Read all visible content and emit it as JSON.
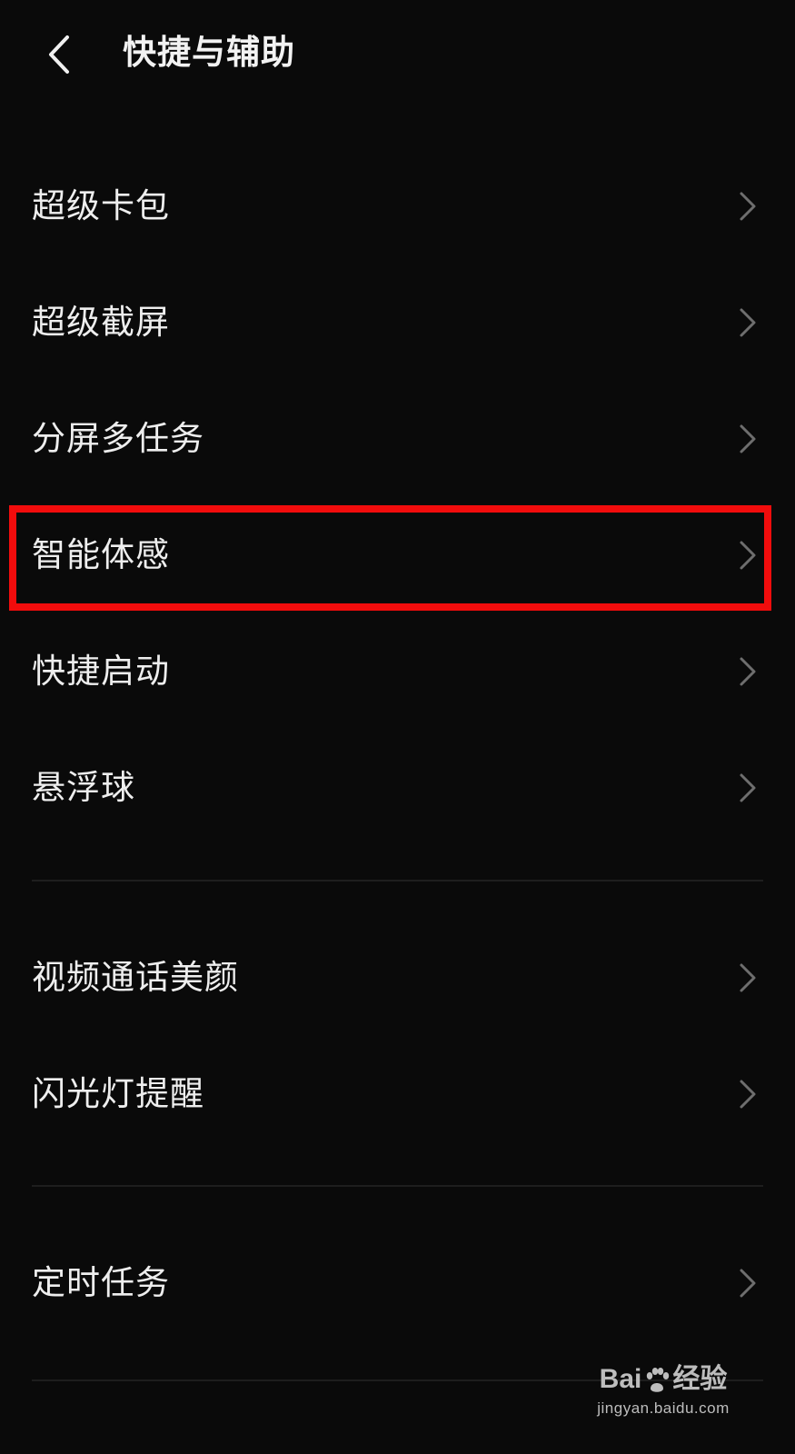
{
  "header": {
    "title": "快捷与辅助",
    "back_icon": "chevron-left-icon"
  },
  "items": [
    {
      "label": "超级卡包"
    },
    {
      "label": "超级截屏"
    },
    {
      "label": "分屏多任务"
    },
    {
      "label": "智能体感",
      "highlighted": true
    },
    {
      "label": "快捷启动"
    },
    {
      "label": "悬浮球"
    },
    {
      "label": "视频通话美颜"
    },
    {
      "label": "闪光灯提醒"
    },
    {
      "label": "定时任务"
    }
  ],
  "colors": {
    "background": "#0a0a0a",
    "text": "#eeeeee",
    "chevron": "#6e6e6e",
    "highlight": "#f20c0c"
  },
  "watermark": {
    "brand_left": "Bai",
    "brand_right": "经验",
    "url": "jingyan.baidu.com"
  }
}
